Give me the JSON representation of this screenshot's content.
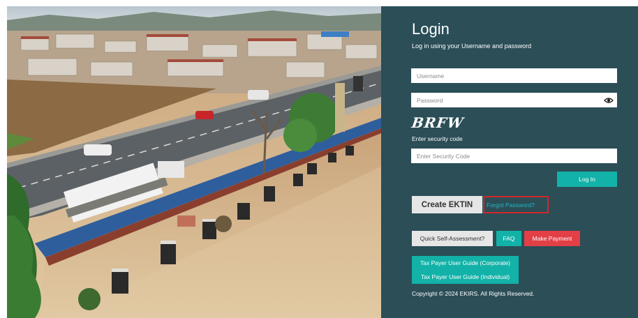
{
  "login": {
    "title": "Login",
    "subtitle": "Log in using your Username and password",
    "username_placeholder": "Username",
    "password_placeholder": "Password",
    "captcha_text": "BRFW",
    "security_label": "Enter security code",
    "security_placeholder": "Enter Security Code",
    "login_button": "Log In",
    "create_button": "Create EKTIN",
    "forgot_link": "Forgot Password?",
    "quick_self_assessment": "Quick Self-Assessment?",
    "faq": "FAQ",
    "make_payment": "Make Payment",
    "guide_corporate": "Tax Payer User Guide (Corporate)",
    "guide_individual": "Tax Payer User Guide (Individual)",
    "copyright": "Copyright © 2024 EKIRS. All Rights Reserved."
  },
  "colors": {
    "panel": "#2b4e57",
    "teal": "#13b2a8",
    "red": "#e23f46",
    "forgot_border": "#d6262a"
  },
  "icons": {
    "password_toggle": "eye-icon"
  }
}
